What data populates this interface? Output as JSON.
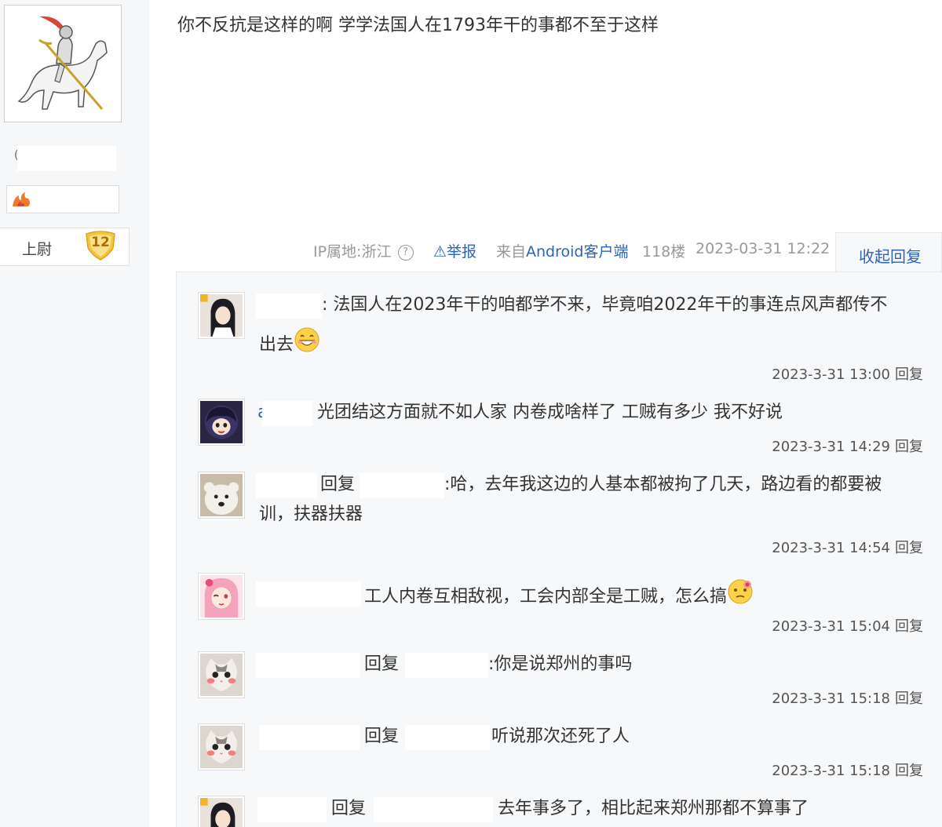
{
  "author": {
    "paren": "(",
    "level_title": "上尉",
    "level": "12",
    "badge_icon": "flame-badge-icon"
  },
  "post": {
    "text": "你不反抗是这样的啊 学学法国人在1793年干的事都不至于这样",
    "ip_label": "IP属地:浙江",
    "help_icon": "?",
    "report_icon": "⚠",
    "report_label": "举报",
    "client_prefix": "来自",
    "client_app": "Android客户端",
    "floor": "118楼",
    "date": "2023-03-31 12:22",
    "collapse_label": "收起回复"
  },
  "replies": [
    {
      "text": ": 法国人在2023年干的咱都学不来，毕竟咱2022年干的事连点风声都传不",
      "text_cont": "出去",
      "emoji": "grin-emoji",
      "time": "2023-3-31 13:00",
      "reply_label": "回复"
    },
    {
      "prefix": "a",
      "text": "光团结这方面就不如人家 内卷成啥样了 工贼有多少 我不好说",
      "time": "2023-3-31 14:29",
      "reply_label": "回复"
    },
    {
      "reply_word": "回复",
      "text": ":哈，去年我这边的人基本都被拘了几天，路边看的都要被",
      "text_cont": "训，扶器扶器",
      "time": "2023-3-31 14:54",
      "reply_label": "回复"
    },
    {
      "text": "工人内卷互相敌视，工会内部全是工贼，怎么搞",
      "emoji": "confused-emoji",
      "time": "2023-3-31 15:04",
      "reply_label": "回复"
    },
    {
      "reply_word": "回复",
      "text": ":你是说郑州的事吗",
      "time": "2023-3-31 15:18",
      "reply_label": "回复"
    },
    {
      "reply_word": "回复",
      "text": "听说那次还死了人",
      "time": "2023-3-31 15:18",
      "reply_label": "回复"
    },
    {
      "reply_word": "回复",
      "text": "去年事多了，相比起来郑州那都不算事了"
    }
  ],
  "colors": {
    "link": "#2d64b3",
    "panel_bg": "#f7f8fa",
    "left_bg": "#f6f7f8",
    "level_gold": "#f5c542"
  }
}
